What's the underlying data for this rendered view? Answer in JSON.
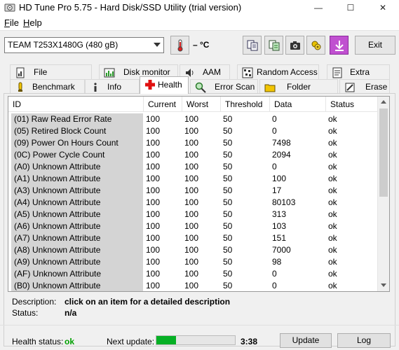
{
  "window": {
    "title": "HD Tune Pro 5.75 - Hard Disk/SSD Utility (trial version)",
    "controls": {
      "minimize": "—",
      "maximize": "☐",
      "close": "✕"
    }
  },
  "menu": [
    {
      "label": "File",
      "accel": "F",
      "rest": "ile"
    },
    {
      "label": "Help",
      "accel": "H",
      "rest": "elp"
    }
  ],
  "toolbar": {
    "drive": "TEAM T253X1480G (480 gB)",
    "temperature": "– °C",
    "exit_label": "Exit",
    "icons": [
      "copy-text-icon",
      "copy-info-icon",
      "screenshot-camera-icon",
      "options-icon",
      "save-icon"
    ]
  },
  "tabs_row1": [
    {
      "label": "File Benchmark",
      "icon": "file-benchmark-icon"
    },
    {
      "label": "Disk monitor",
      "icon": "disk-monitor-icon"
    },
    {
      "label": "AAM",
      "icon": "speaker-icon"
    },
    {
      "label": "Random Access",
      "icon": "random-access-icon"
    },
    {
      "label": "Extra tests",
      "icon": "extra-tests-icon"
    }
  ],
  "tabs_row2": [
    {
      "label": "Benchmark",
      "icon": "benchmark-icon"
    },
    {
      "label": "Info",
      "icon": "info-icon"
    },
    {
      "label": "Health",
      "icon": "health-cross-icon",
      "active": true
    },
    {
      "label": "Error Scan",
      "icon": "magnifier-icon"
    },
    {
      "label": "Folder Usage",
      "icon": "folder-icon"
    },
    {
      "label": "Erase",
      "icon": "erase-icon"
    }
  ],
  "table": {
    "columns": [
      "ID",
      "Current",
      "Worst",
      "Threshold",
      "Data",
      "Status"
    ],
    "rows": [
      [
        "(01) Raw Read Error Rate",
        "100",
        "100",
        "50",
        "0",
        "ok"
      ],
      [
        "(05) Retired Block Count",
        "100",
        "100",
        "50",
        "0",
        "ok"
      ],
      [
        "(09) Power On Hours Count",
        "100",
        "100",
        "50",
        "7498",
        "ok"
      ],
      [
        "(0C) Power Cycle Count",
        "100",
        "100",
        "50",
        "2094",
        "ok"
      ],
      [
        "(A0) Unknown Attribute",
        "100",
        "100",
        "50",
        "0",
        "ok"
      ],
      [
        "(A1) Unknown Attribute",
        "100",
        "100",
        "50",
        "100",
        "ok"
      ],
      [
        "(A3) Unknown Attribute",
        "100",
        "100",
        "50",
        "17",
        "ok"
      ],
      [
        "(A4) Unknown Attribute",
        "100",
        "100",
        "50",
        "80103",
        "ok"
      ],
      [
        "(A5) Unknown Attribute",
        "100",
        "100",
        "50",
        "313",
        "ok"
      ],
      [
        "(A6) Unknown Attribute",
        "100",
        "100",
        "50",
        "103",
        "ok"
      ],
      [
        "(A7) Unknown Attribute",
        "100",
        "100",
        "50",
        "151",
        "ok"
      ],
      [
        "(A8) Unknown Attribute",
        "100",
        "100",
        "50",
        "7000",
        "ok"
      ],
      [
        "(A9) Unknown Attribute",
        "100",
        "100",
        "50",
        "98",
        "ok"
      ],
      [
        "(AF) Unknown Attribute",
        "100",
        "100",
        "50",
        "0",
        "ok"
      ],
      [
        "(B0) Unknown Attribute",
        "100",
        "100",
        "50",
        "0",
        "ok"
      ]
    ]
  },
  "description": {
    "label": "Description:",
    "value": "click on an item for a detailed description",
    "status_label": "Status:",
    "status_value": "n/a"
  },
  "footer": {
    "health_label": "Health status:",
    "health_value": "ok",
    "health_color": "#00a000",
    "next_update_label": "Next update:",
    "progress_fraction": 0.25,
    "countdown": "3:38",
    "update_label": "Update",
    "log_label": "Log"
  }
}
